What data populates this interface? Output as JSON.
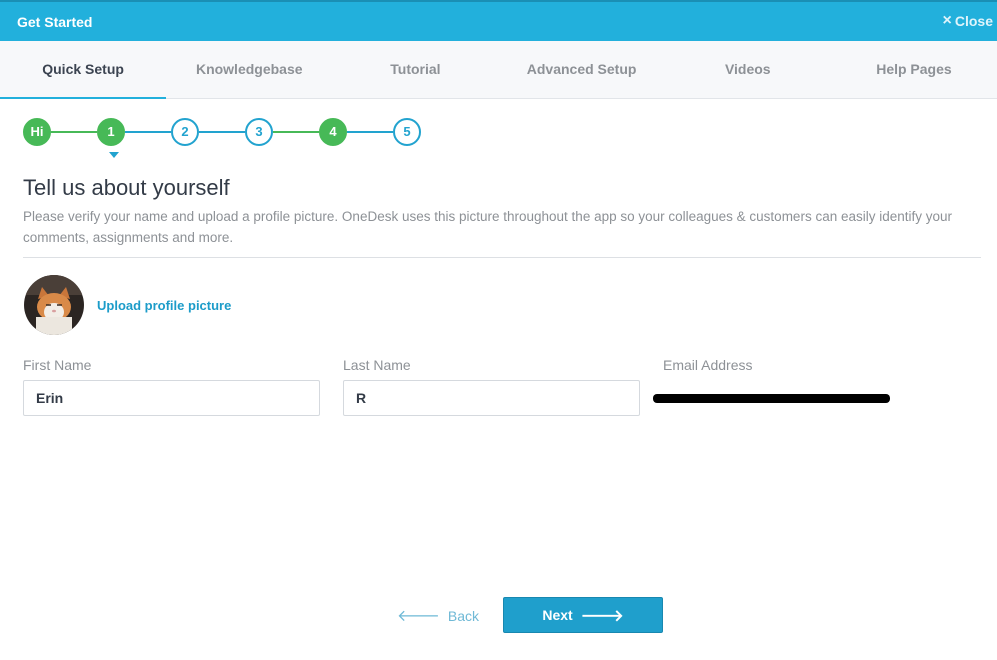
{
  "header": {
    "title": "Get Started",
    "close_label": "Close",
    "close_icon": "×"
  },
  "tabs": [
    {
      "label": "Quick Setup",
      "active": true
    },
    {
      "label": "Knowledgebase",
      "active": false
    },
    {
      "label": "Tutorial",
      "active": false
    },
    {
      "label": "Advanced Setup",
      "active": false
    },
    {
      "label": "Videos",
      "active": false
    },
    {
      "label": "Help Pages",
      "active": false
    }
  ],
  "stepper": {
    "current_step": 1,
    "steps": [
      {
        "label": "Hi",
        "state": "done"
      },
      {
        "label": "1",
        "state": "done"
      },
      {
        "label": "2",
        "state": "todo"
      },
      {
        "label": "3",
        "state": "todo"
      },
      {
        "label": "4",
        "state": "done"
      },
      {
        "label": "5",
        "state": "todo"
      }
    ]
  },
  "page": {
    "title": "Tell us about yourself",
    "description": "Please verify your name and upload a profile picture. OneDesk uses this picture throughout the app so your colleagues & customers can easily identify your comments, assignments and more."
  },
  "profile": {
    "upload_label": "Upload profile picture"
  },
  "form": {
    "first_name": {
      "label": "First Name",
      "value": "Erin"
    },
    "last_name": {
      "label": "Last Name",
      "value": "R"
    },
    "email": {
      "label": "Email Address"
    }
  },
  "footer": {
    "back_label": "Back",
    "next_label": "Next"
  },
  "colors": {
    "accent": "#22b0dc",
    "done": "#47b957",
    "todo": "#22a3cf"
  }
}
